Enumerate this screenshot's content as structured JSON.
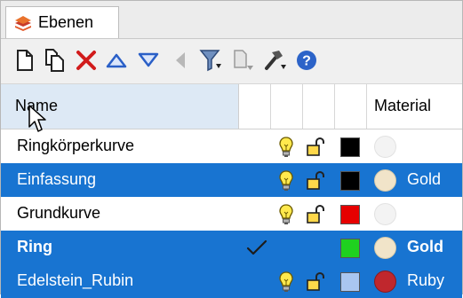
{
  "panel": {
    "tab_label": "Ebenen",
    "tab_icon": "layers-icon"
  },
  "toolbar": {
    "buttons": [
      {
        "name": "new-layer-icon"
      },
      {
        "name": "new-sublayer-icon"
      },
      {
        "name": "delete-icon",
        "color": "#d11b1b"
      },
      {
        "name": "move-up-icon",
        "color": "#2a5fc7"
      },
      {
        "name": "move-down-icon",
        "color": "#2a5fc7"
      },
      {
        "name": "move-to-parent-icon"
      },
      {
        "name": "filter-icon"
      },
      {
        "name": "layer-copy-icon"
      },
      {
        "name": "tools-icon"
      },
      {
        "name": "help-icon",
        "color": "#2c63c8"
      }
    ]
  },
  "columns": {
    "name": "Name",
    "material": "Material"
  },
  "rows": [
    {
      "name": "Ringkörperkurve",
      "selected": false,
      "bold": false,
      "current": false,
      "visible": true,
      "locked": false,
      "color": "#000000",
      "material_color": "#f3f3f3",
      "material": ""
    },
    {
      "name": "Einfassung",
      "selected": true,
      "bold": false,
      "current": false,
      "visible": true,
      "locked": false,
      "color": "#000000",
      "material_color": "#f1e4c9",
      "material": "Gold"
    },
    {
      "name": "Grundkurve",
      "selected": false,
      "bold": false,
      "current": false,
      "visible": true,
      "locked": false,
      "color": "#e60000",
      "material_color": "#f3f3f3",
      "material": ""
    },
    {
      "name": "Ring",
      "selected": true,
      "bold": true,
      "current": true,
      "visible": null,
      "locked": null,
      "color": "#1fd11f",
      "material_color": "#f1e4c9",
      "material": "Gold"
    },
    {
      "name": "Edelstein_Rubin",
      "selected": true,
      "bold": false,
      "current": false,
      "visible": true,
      "locked": false,
      "color": "#a9c6f0",
      "material_color": "#c0272d",
      "material": "Ruby"
    }
  ],
  "colors": {
    "selection": "#1874d1",
    "header_highlight": "#dde9f5"
  }
}
